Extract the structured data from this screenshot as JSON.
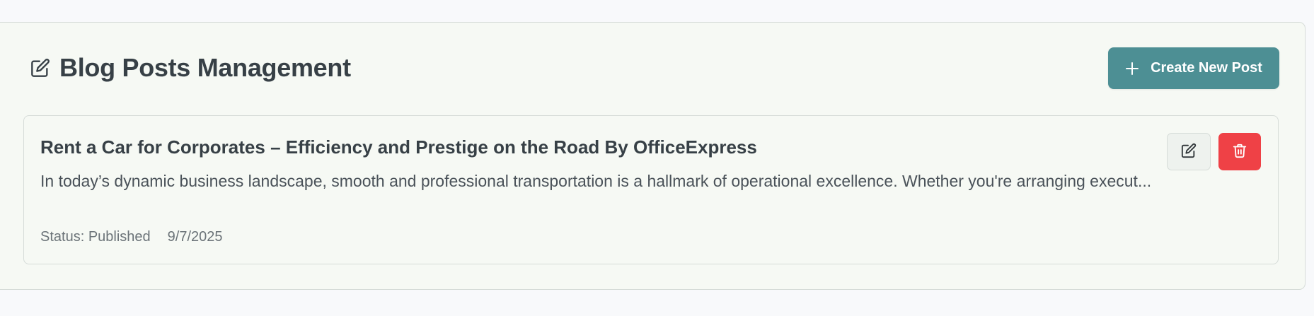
{
  "header": {
    "title": "Blog Posts Management",
    "icon": "edit-icon",
    "create_button_label": "Create New Post",
    "create_button_icon": "plus-icon"
  },
  "posts": [
    {
      "title": "Rent a Car for Corporates – Efficiency and Prestige on the Road By OfficeExpress",
      "excerpt": "In today’s dynamic business landscape, smooth and professional transportation is a hallmark of operational excellence. Whether you're arranging execut...",
      "status": "Status: Published",
      "date": "9/7/2025",
      "edit_icon": "edit-icon",
      "delete_icon": "trash-icon"
    }
  ],
  "colors": {
    "accent": "#4d8f94",
    "danger": "#ef4146",
    "panel_bg": "#f6f9f4",
    "page_bg": "#f8f9fb"
  }
}
